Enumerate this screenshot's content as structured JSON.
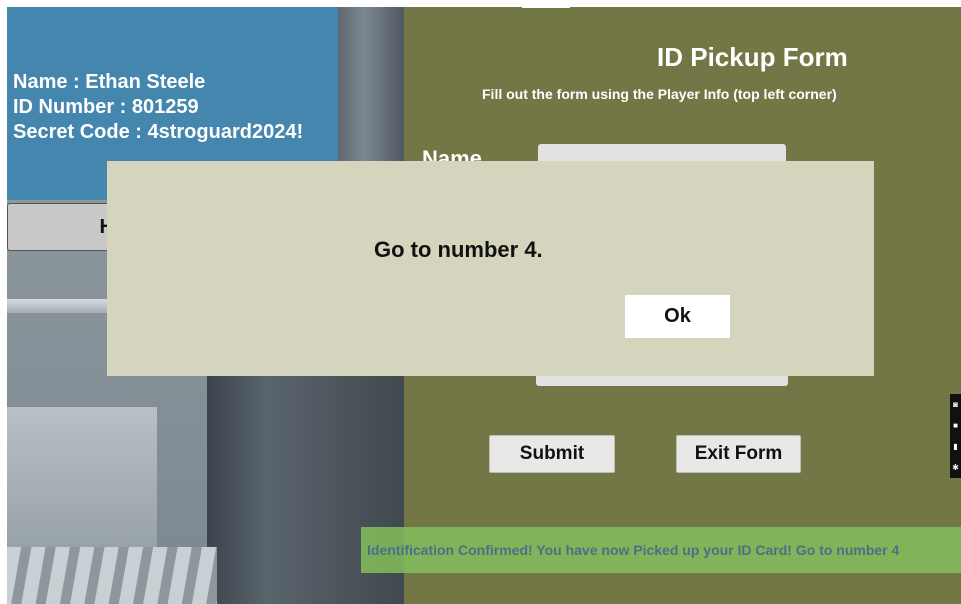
{
  "player_info": {
    "name_line": "Name : Ethan Steele",
    "id_line": "ID Number : 801259",
    "code_line": "Secret Code : 4stroguard2024!"
  },
  "help_button_label": "H",
  "form": {
    "title": "ID Pickup Form",
    "subtitle": "Fill out the form using the Player Info (top left corner)",
    "name_label": "Name",
    "submit_label": "Submit",
    "exit_label": "Exit Form"
  },
  "banner": {
    "text": "Identification Confirmed! You have now Picked up your ID Card! Go to number 4"
  },
  "modal": {
    "message": "Go to number 4.",
    "ok_label": "Ok"
  },
  "colors": {
    "info_panel": "#4486ae",
    "form_panel": "#737745",
    "modal_bg": "#d5d4bd",
    "banner_bg": "#84be5c"
  }
}
